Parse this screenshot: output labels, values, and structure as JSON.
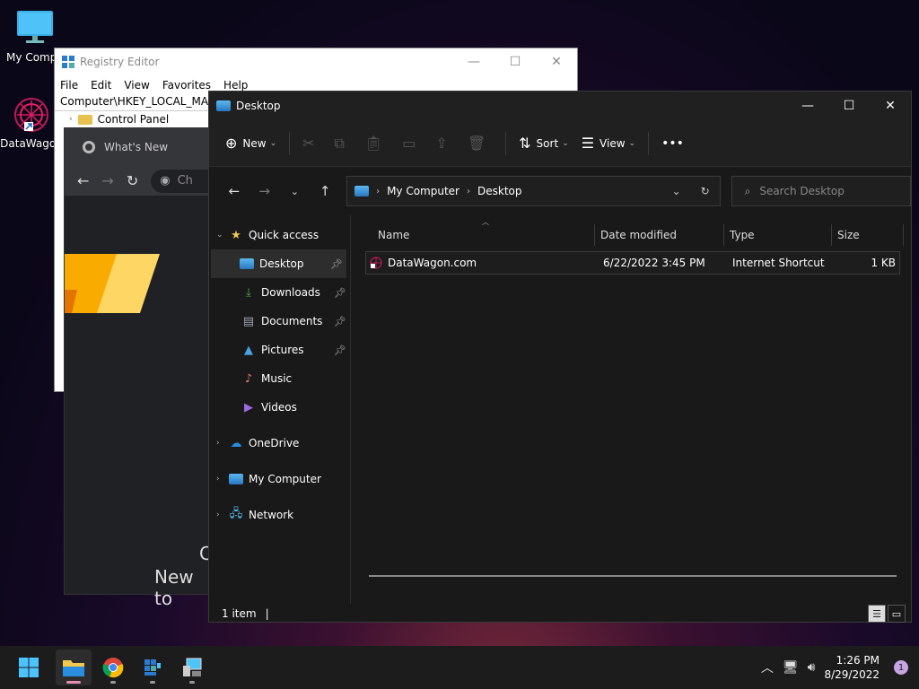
{
  "desktop": {
    "icons": [
      {
        "label": "My Compu",
        "icon": "monitor-icon"
      },
      {
        "label": "DataWagon",
        "icon": "datawagon-icon"
      }
    ]
  },
  "regedit": {
    "title": "Registry Editor",
    "menu": [
      "File",
      "Edit",
      "View",
      "Favorites",
      "Help"
    ],
    "address": "Computer\\HKEY_LOCAL_MACH",
    "tree_item": "Control Panel"
  },
  "chrome": {
    "tab_title": "What's New",
    "omnibox_partial": "Ch",
    "ntp_text_1": "C",
    "ntp_text_2": "New to"
  },
  "explorer": {
    "title": "Desktop",
    "commands": {
      "new": "New",
      "sort": "Sort",
      "view": "View",
      "more": "•••"
    },
    "breadcrumb": [
      "My Computer",
      "Desktop"
    ],
    "search_placeholder": "Search Desktop",
    "nav": {
      "quick_access": "Quick access",
      "items": [
        "Desktop",
        "Downloads",
        "Documents",
        "Pictures",
        "Music",
        "Videos"
      ],
      "onedrive": "OneDrive",
      "my_computer": "My Computer",
      "network": "Network"
    },
    "columns": [
      "Name",
      "Date modified",
      "Type",
      "Size"
    ],
    "rows": [
      {
        "name": "DataWagon.com",
        "date": "6/22/2022 3:45 PM",
        "type": "Internet Shortcut",
        "size": "1 KB"
      }
    ],
    "status": "1 item"
  },
  "taskbar": {
    "time": "1:26 PM",
    "date": "8/29/2022",
    "notification_count": "1"
  },
  "colors": {
    "accent": "#e58fb7",
    "folder": "#e8c150"
  }
}
